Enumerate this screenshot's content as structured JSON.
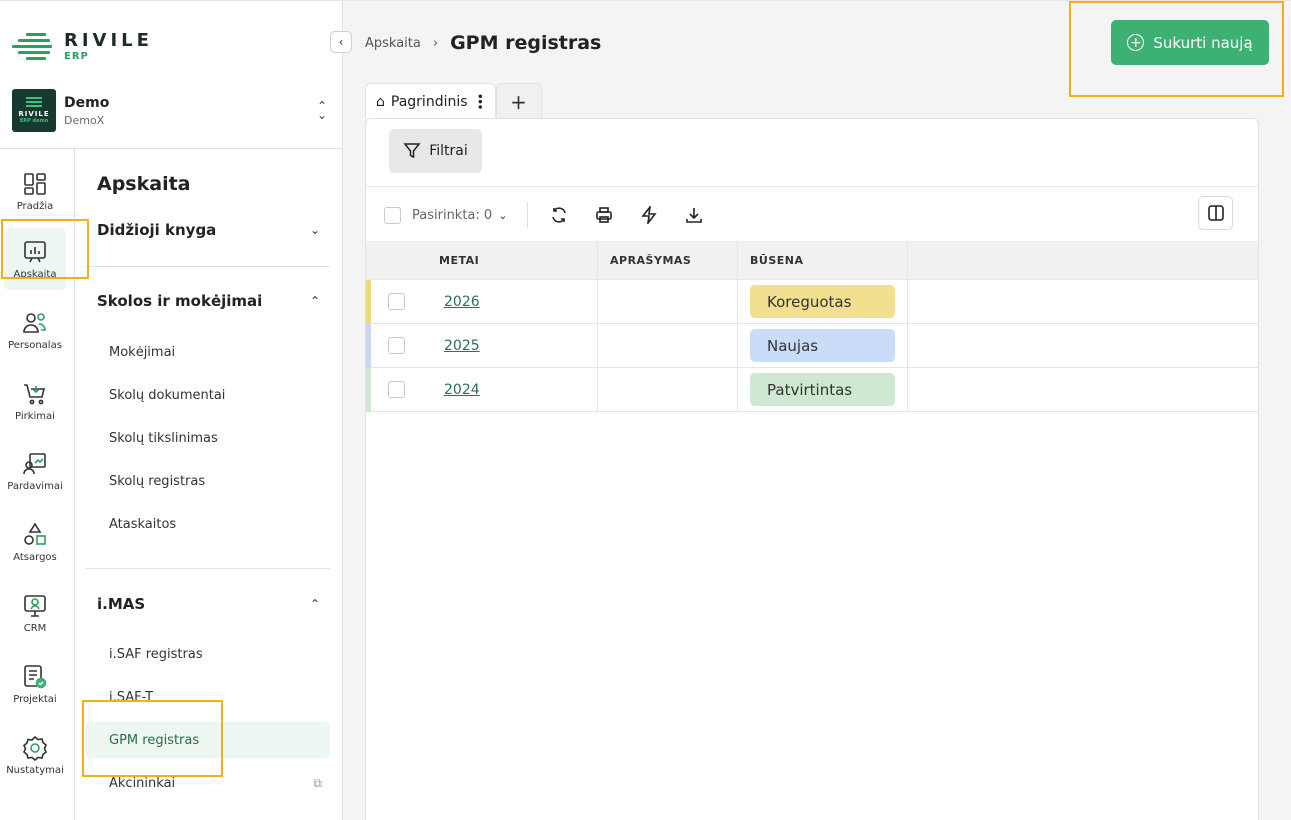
{
  "brand": {
    "logo_title": "RIVILE",
    "logo_sub": "ERP",
    "logo_color": "#2e9e62",
    "company_name": "Demo",
    "company_sub": "DemoX",
    "company_logo_text": "RIVILE",
    "company_logo_sub": "ERP demo"
  },
  "rail": {
    "items": [
      {
        "label": "Pradžia",
        "icon": "dashboard-icon"
      },
      {
        "label": "Apskaita",
        "icon": "chart-board-icon",
        "active": true
      },
      {
        "label": "Personalas",
        "icon": "people-icon"
      },
      {
        "label": "Pirkimai",
        "icon": "cart-icon"
      },
      {
        "label": "Pardavimai",
        "icon": "sales-icon"
      },
      {
        "label": "Atsargos",
        "icon": "shapes-icon"
      },
      {
        "label": "CRM",
        "icon": "crm-icon"
      },
      {
        "label": "Projektai",
        "icon": "project-icon"
      },
      {
        "label": "Nustatymai",
        "icon": "gear-icon"
      }
    ]
  },
  "submenu": {
    "title": "Apskaita",
    "groups": [
      {
        "label": "Didžioji knyga",
        "expanded": false
      },
      {
        "label": "Skolos ir mokėjimai",
        "expanded": true,
        "items": [
          "Mokėjimai",
          "Skolų dokumentai",
          "Skolų tikslinimas",
          "Skolų registras",
          "Ataskaitos"
        ]
      },
      {
        "label": "i.MAS",
        "expanded": true,
        "items": [
          "i.SAF registras",
          "i.SAF-T",
          "GPM registras",
          "Akcininkai"
        ]
      }
    ],
    "active_item": "GPM registras"
  },
  "header": {
    "breadcrumb_parent": "Apskaita",
    "page_title": "GPM registras",
    "create_label": "Sukurti naują",
    "accent_color": "#3db173"
  },
  "tabs": {
    "main_label": "Pagrindinis",
    "add_label": "+"
  },
  "toolbar": {
    "filters_label": "Filtrai",
    "selected_label": "Pasirinkta: 0"
  },
  "table": {
    "columns": [
      "METAI",
      "APRAŠYMAS",
      "BŪSENA"
    ],
    "rows": [
      {
        "year": "2026",
        "description": "",
        "status": "Koreguotas",
        "status_color": "#f3df90",
        "strip_color": "#f0d97a"
      },
      {
        "year": "2025",
        "description": "",
        "status": "Naujas",
        "status_color": "#c9dcf8",
        "strip_color": "#c6d8f6"
      },
      {
        "year": "2024",
        "description": "",
        "status": "Patvirtintas",
        "status_color": "#cfe8d2",
        "strip_color": "#cfe8d2"
      }
    ]
  }
}
